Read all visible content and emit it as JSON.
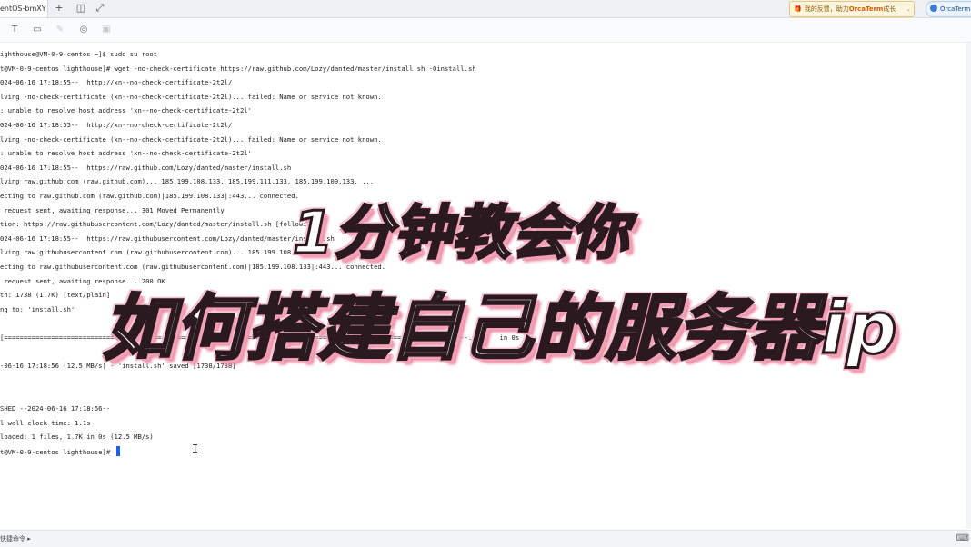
{
  "tab": {
    "title": "entOS-bmXY"
  },
  "notice": {
    "text_a": "我的反馈，",
    "text_b": "助力",
    "brand": "OrcaTerm",
    "text_c": "成长"
  },
  "orca": {
    "label": "OrcaTerm"
  },
  "terminal": {
    "lines": [
      "ighthouse@VM-0-9-centos ~]$ sudo su root",
      "t@VM-0-9-centos lighthouse]# wget -no-check-certificate https://raw.github.com/Lozy/danted/master/install.sh -Oinstall.sh",
      "024-06-16 17:18:55--  http://xn--no-check-certificate-2t2l/",
      "lving -no-check-certificate (xn--no-check-certificate-2t2l)... failed: Name or service not known.",
      ": unable to resolve host address 'xn--no-check-certificate-2t2l'",
      "024-06-16 17:18:55--  http://xn--no-check-certificate-2t2l/",
      "lving -no-check-certificate (xn--no-check-certificate-2t2l)... failed: Name or service not known.",
      ": unable to resolve host address 'xn--no-check-certificate-2t2l'",
      "024-06-16 17:18:55--  https://raw.github.com/Lozy/danted/master/install.sh",
      "lving raw.github.com (raw.github.com)... 185.199.108.133, 185.199.111.133, 185.199.109.133, ...",
      "ecting to raw.github.com (raw.github.com)|185.199.108.133|:443... connected.",
      " request sent, awaiting response... 301 Moved Permanently",
      "tion: https://raw.githubusercontent.com/Lozy/danted/master/install.sh [following]",
      "024-06-16 17:18:55--  https://raw.githubusercontent.com/Lozy/danted/master/install.sh",
      "lving raw.githubusercontent.com (raw.githubusercontent.com)... 185.199.108.133, ...",
      "ecting to raw.githubusercontent.com (raw.githubusercontent.com)|185.199.108.133|:443... connected.",
      " request sent, awaiting response... 200 OK",
      "th: 1738 (1.7K) [text/plain]",
      "ng to: 'install.sh'",
      "",
      "[=======================================================================================================] 1,738      --.-K/s   in 0s",
      "",
      "-06-16 17:18:56 (12.5 MB/s) - 'install.sh' saved [1738/1738]",
      "",
      "",
      "SHED --2024-06-16 17:18:56--",
      "l wall clock time: 1.1s",
      "loaded: 1 files, 1.7K in 0s (12.5 MB/s)",
      "t@VM-0-9-centos lighthouse]# "
    ]
  },
  "overlay": {
    "line1": "1分钟教会你",
    "line2": "如何搭建自己的服务器ip"
  },
  "statusbar": {
    "label": "快捷命令 ▸"
  }
}
